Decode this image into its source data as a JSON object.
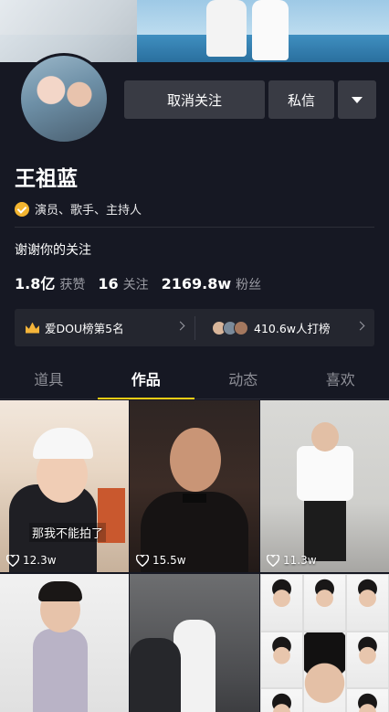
{
  "profile": {
    "name": "王祖蓝",
    "verification": "演员、歌手、主持人",
    "bio": "谢谢你的关注"
  },
  "actions": {
    "unfollow_label": "取消关注",
    "message_label": "私信",
    "more_icon": "caret-down-icon"
  },
  "stats": [
    {
      "value": "1.8亿",
      "label": "获赞"
    },
    {
      "value": "16",
      "label": "关注"
    },
    {
      "value": "2169.8w",
      "label": "粉丝"
    }
  ],
  "ranking": {
    "left_text": "爱DOU榜第5名",
    "right_text": "410.6w人打榜"
  },
  "tabs": [
    {
      "label": "道具",
      "active": false
    },
    {
      "label": "作品",
      "active": true
    },
    {
      "label": "动态",
      "active": false
    },
    {
      "label": "喜欢",
      "active": false
    }
  ],
  "videos": [
    {
      "likes": "12.3w",
      "caption": "那我不能拍了"
    },
    {
      "likes": "15.5w"
    },
    {
      "likes": "11.3w"
    },
    {
      "likes": ""
    },
    {
      "likes": ""
    },
    {
      "likes": ""
    }
  ],
  "colors": {
    "background": "#161823",
    "button": "#393b44",
    "accent": "#face15",
    "verify_badge": "#f3b530"
  }
}
